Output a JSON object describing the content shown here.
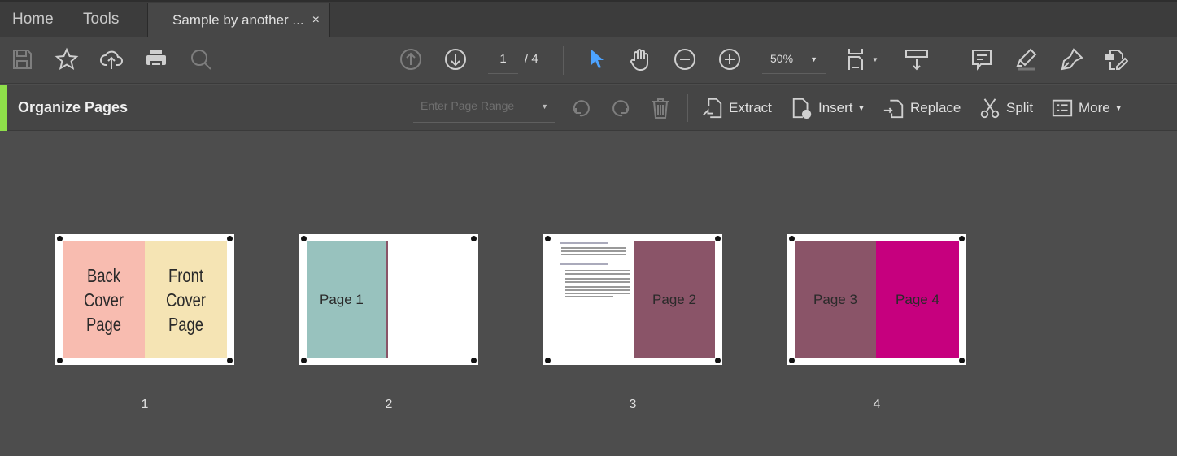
{
  "tabs": {
    "home": "Home",
    "tools": "Tools",
    "document": "Sample by another ...",
    "close": "×"
  },
  "toolbar": {
    "page_current": "1",
    "page_total": "/ 4",
    "zoom": "50%"
  },
  "organize": {
    "title": "Organize Pages",
    "page_range_placeholder": "Enter Page Range",
    "extract": "Extract",
    "insert": "Insert",
    "replace": "Replace",
    "split": "Split",
    "more": "More"
  },
  "thumbnails": [
    {
      "label": "1",
      "left": "Back\nCover Page",
      "right": "Front\nCover Page",
      "left_color": "#f8bcb0",
      "right_color": "#f5e4b4"
    },
    {
      "label": "2",
      "left": "Page 1",
      "left_color": "#98c2be"
    },
    {
      "label": "3",
      "right": "Page 2",
      "right_color": "#8a5468"
    },
    {
      "label": "4",
      "left": "Page 3",
      "right": "Page 4",
      "left_color": "#8a5468",
      "right_color": "#c6007e"
    }
  ],
  "colors": {
    "accent": "#8fe04a",
    "select_tool": "#4da3ff"
  }
}
